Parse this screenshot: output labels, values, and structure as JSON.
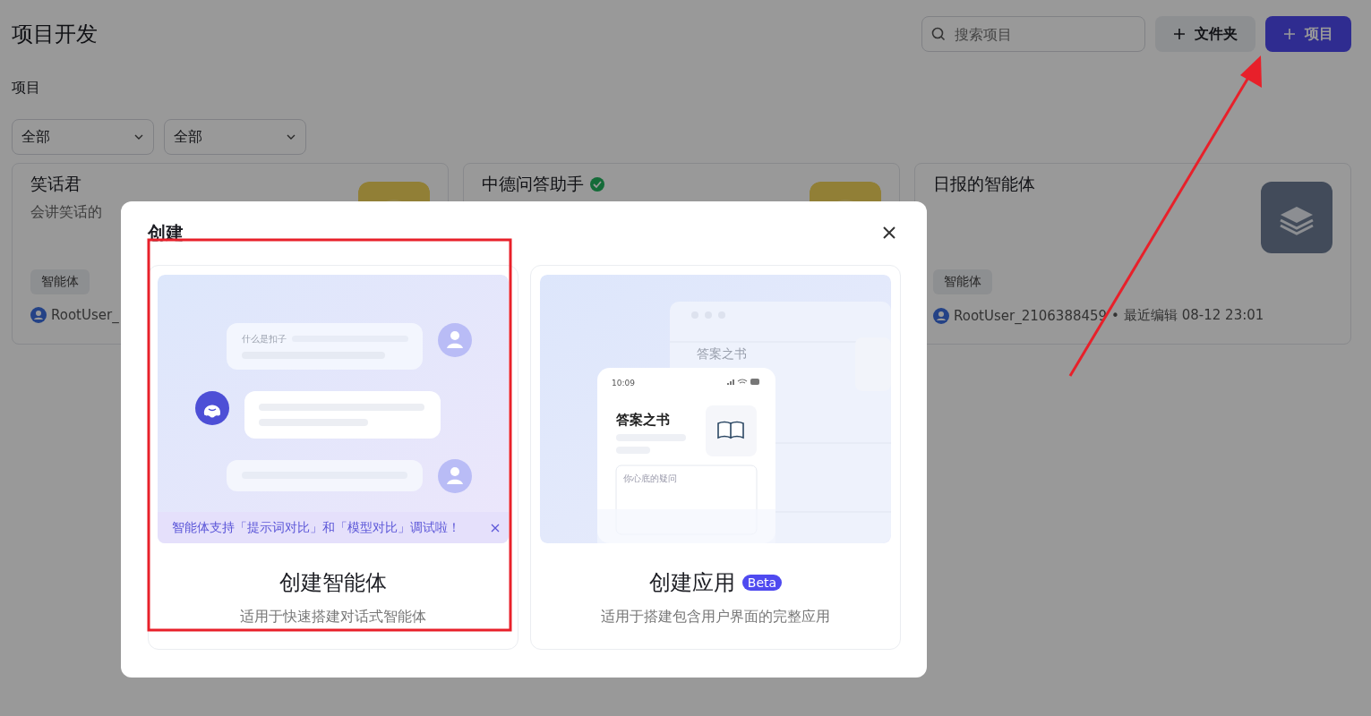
{
  "header": {
    "title": "项目开发",
    "search": {
      "placeholder": "搜索项目"
    },
    "buttons": [
      {
        "label": "文件夹",
        "kind": "secondary"
      },
      {
        "label": "项目",
        "kind": "primary"
      }
    ]
  },
  "section_label": "项目",
  "filters": [
    {
      "value": "全部"
    },
    {
      "value": "全部"
    }
  ],
  "cards": [
    {
      "kind": "picture",
      "title": "笑话君",
      "verified": false,
      "description": "会讲笑话的",
      "tag": "智能体",
      "owner": "RootUser_"
    },
    {
      "kind": "picture",
      "title": "中德问答助手",
      "verified": true
    },
    {
      "kind": "layers",
      "title": "日报的智能体",
      "verified": false,
      "tag": "智能体",
      "owner": "RootUser_2106388459",
      "separator": "•",
      "edited": "最近编辑 08-12 23:01"
    }
  ],
  "modal": {
    "title": "创建",
    "options": [
      {
        "kind": "agent",
        "title": "创建智能体",
        "subtitle": "适用于快速搭建对话式智能体",
        "notice": "智能体支持「提示词对比」和「模型对比」调试啦！",
        "preview": {
          "question": "什么是扣子"
        }
      },
      {
        "kind": "app",
        "title": "创建应用",
        "badge": "Beta",
        "subtitle": "适用于搭建包含用户界面的完整应用",
        "preview": {
          "window_title": "答案之书",
          "time": "10:09",
          "app_name": "答案之书",
          "input_placeholder": "你心底的疑问"
        }
      }
    ]
  }
}
